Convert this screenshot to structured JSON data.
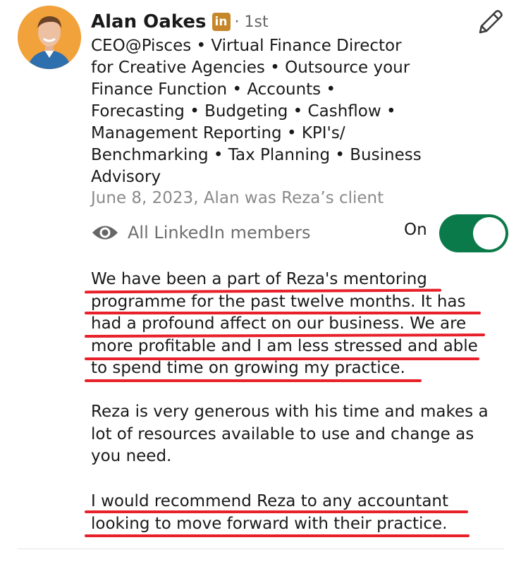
{
  "profile": {
    "name": "Alan Oakes",
    "linkedin_badge": "in",
    "degree": "· 1st",
    "headline_lines": [
      "CEO@Pisces • Virtual Finance Director",
      "for Creative Agencies • Outsource your",
      "Finance Function • Accounts •",
      "Forecasting • Budgeting • Cashflow •",
      "Management Reporting • KPI's/",
      "Benchmarking • Tax Planning • Business",
      "Advisory"
    ],
    "meta": "June 8, 2023, Alan was Reza’s client"
  },
  "visibility": {
    "label": "All LinkedIn members",
    "toggle_label": "On",
    "toggle_on": true
  },
  "recommendation": {
    "paragraph1_lines": [
      "We have been a part of Reza's mentoring",
      "programme for the past twelve months. It has",
      "had a profound affect on our business. We are",
      "more profitable and I am less stressed and able",
      "to spend time on growing my practice."
    ],
    "paragraph2_lines": [
      "Reza is very generous with his time and makes a",
      "lot of resources available to use and change as",
      "you need."
    ],
    "paragraph3_lines": [
      "I would recommend Reza to any accountant",
      "looking to move forward with their practice."
    ]
  },
  "icons": {
    "edit": "pencil-icon",
    "visibility": "eye-icon"
  },
  "colors": {
    "toggle_on": "#0b7a4a",
    "linkedin_badge": "#c6872a",
    "underline": "#e8202a"
  }
}
